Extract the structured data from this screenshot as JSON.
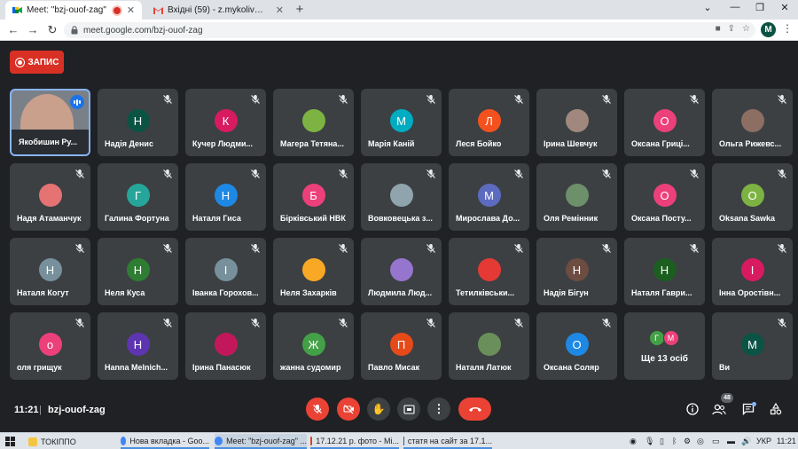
{
  "browser": {
    "tabs": [
      {
        "title": "Meet: \"bzj-ouof-zag\"",
        "icon": "google-meet-icon"
      },
      {
        "title": "Вхідні (59) - z.mykoliv@ippo.edu",
        "icon": "gmail-icon"
      }
    ],
    "url": "meet.google.com/bzj-ouof-zag",
    "profile_initial": "M"
  },
  "meet": {
    "record_label": "ЗАПИС",
    "self_name": "Якобишин Ру...",
    "participants": [
      {
        "name": "Надія Денис",
        "initial": "Н",
        "color": "#0b5345"
      },
      {
        "name": "Кучер Людми...",
        "initial": "К",
        "color": "#d81b60"
      },
      {
        "name": "Магера Тетяна...",
        "initial": "",
        "color": "#7cb342"
      },
      {
        "name": "Марія Каній",
        "initial": "М",
        "color": "#00acc1"
      },
      {
        "name": "Леся Бойко",
        "initial": "Л",
        "color": "#f4511e"
      },
      {
        "name": "Ірина Шевчук",
        "initial": "",
        "color": "#a1887f"
      },
      {
        "name": "Оксана Гриці...",
        "initial": "О",
        "color": "#ec407a"
      },
      {
        "name": "Ольга Рижевс...",
        "initial": "",
        "color": "#8d6e63"
      },
      {
        "name": "Надя Атаманчук",
        "initial": "",
        "color": "#e57373"
      },
      {
        "name": "Галина Фортуна",
        "initial": "Г",
        "color": "#26a69a"
      },
      {
        "name": "Наталя Гиса",
        "initial": "Н",
        "color": "#1e88e5"
      },
      {
        "name": "Бірківський НВК",
        "initial": "Б",
        "color": "#ec407a"
      },
      {
        "name": "Вовковецька з...",
        "initial": "",
        "color": "#90a4ae"
      },
      {
        "name": "Мирослава До...",
        "initial": "М",
        "color": "#5c6bc0"
      },
      {
        "name": "Оля Ремінник",
        "initial": "",
        "color": "#6d8f6a"
      },
      {
        "name": "Оксана Посту...",
        "initial": "О",
        "color": "#ec407a"
      },
      {
        "name": "Oksana Sawka",
        "initial": "О",
        "color": "#7cb342"
      },
      {
        "name": "Наталя Когут",
        "initial": "Н",
        "color": "#78909c"
      },
      {
        "name": "Неля Куса",
        "initial": "Н",
        "color": "#2e7d32"
      },
      {
        "name": "Іванка Горохов...",
        "initial": "І",
        "color": "#78909c"
      },
      {
        "name": "Неля Захарків",
        "initial": "",
        "color": "#f9a825"
      },
      {
        "name": "Людмила Люд...",
        "initial": "",
        "color": "#9575cd"
      },
      {
        "name": "Тетилківськи...",
        "initial": "",
        "color": "#e53935"
      },
      {
        "name": "Надія Бігун",
        "initial": "Н",
        "color": "#6d4c41"
      },
      {
        "name": "Наталя Гаври...",
        "initial": "Н",
        "color": "#1b5e20"
      },
      {
        "name": "Інна Оростівн...",
        "initial": "І",
        "color": "#d81b60"
      },
      {
        "name": "оля грищук",
        "initial": "о",
        "color": "#ec407a"
      },
      {
        "name": "Hanna Melnich...",
        "initial": "Н",
        "color": "#5e35b1"
      },
      {
        "name": "Ірина Панасюк",
        "initial": "",
        "color": "#c2185b"
      },
      {
        "name": "жанна судомир",
        "initial": "Ж",
        "color": "#43a047"
      },
      {
        "name": "Павло Мисак",
        "initial": "П",
        "color": "#e64a19"
      },
      {
        "name": "Наталя Латюк",
        "initial": "",
        "color": "#6a8f5a"
      },
      {
        "name": "Оксана Соляр",
        "initial": "О",
        "color": "#1e88e5"
      }
    ],
    "overflow": {
      "label": "Ще 13 осіб",
      "initials": [
        "Г",
        "М"
      ],
      "colors": [
        "#43a047",
        "#ec407a"
      ]
    },
    "last": {
      "name": "Ви",
      "initial": "М",
      "color": "#0b5345"
    },
    "time": "11:21",
    "meeting_code": "bzj-ouof-zag",
    "participant_count": "48"
  },
  "taskbar": {
    "items": [
      {
        "label": "ТОКІППО"
      },
      {
        "label": "Нова вкладка - Goo..."
      },
      {
        "label": "Meet: \"bzj-ouof-zag\" ..."
      },
      {
        "label": "17.12.21 р. фото - Мі..."
      },
      {
        "label": "статя на сайт за 17.1..."
      }
    ],
    "lang": "УКР",
    "clock": "11:21"
  },
  "colors": {
    "accent": "#8ab4f8",
    "danger": "#ea4335",
    "tile": "#3c4043",
    "background": "#202124"
  }
}
